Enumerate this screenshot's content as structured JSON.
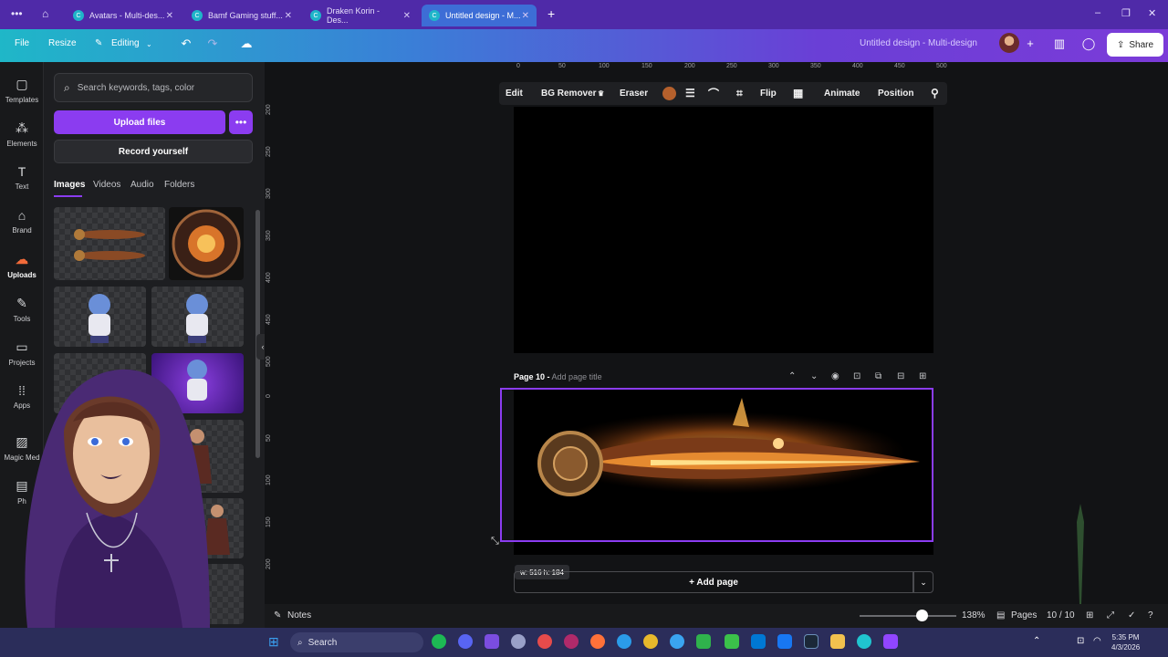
{
  "browser": {
    "tabs": [
      {
        "label": "Avatars - Multi-des..."
      },
      {
        "label": "Bamf Gaming stuff..."
      },
      {
        "label": "Draken Korin - Des..."
      },
      {
        "label": "Untitled design - M..."
      }
    ],
    "new_tab": "+",
    "window_controls": [
      "–",
      "❐",
      "✕"
    ]
  },
  "topbar": {
    "file": "File",
    "resize": "Resize",
    "editing": "Editing",
    "title": "Untitled design - Multi-design",
    "share": "Share"
  },
  "rail": {
    "items": [
      {
        "label": "Templates",
        "icon": "templates-icon"
      },
      {
        "label": "Elements",
        "icon": "elements-icon"
      },
      {
        "label": "Text",
        "icon": "text-icon"
      },
      {
        "label": "Brand",
        "icon": "brand-icon"
      },
      {
        "label": "Uploads",
        "icon": "uploads-icon"
      },
      {
        "label": "Tools",
        "icon": "tools-icon"
      },
      {
        "label": "Projects",
        "icon": "projects-icon"
      },
      {
        "label": "Apps",
        "icon": "apps-icon"
      },
      {
        "label": "Magic Med",
        "icon": "magic-media-icon"
      },
      {
        "label": "Ph",
        "icon": "photos-icon"
      }
    ]
  },
  "panel": {
    "search_placeholder": "Search keywords, tags, color",
    "upload": "Upload files",
    "record": "Record yourself",
    "tabs": [
      "Images",
      "Videos",
      "Audio",
      "Folders"
    ]
  },
  "ruler": {
    "top": [
      "0",
      "50",
      "100",
      "150",
      "200",
      "250",
      "300",
      "350",
      "400",
      "450",
      "500"
    ],
    "left": [
      "200",
      "250",
      "300",
      "350",
      "400",
      "450",
      "500",
      "0",
      "50",
      "100",
      "150",
      "200"
    ]
  },
  "toolbar": {
    "edit": "Edit",
    "bg_remover": "BG Remover",
    "eraser": "Eraser",
    "flip": "Flip",
    "animate": "Animate",
    "position": "Position",
    "swatch_color": "#b5602c"
  },
  "page": {
    "number": "Page 10 -",
    "title_placeholder": "Add page title",
    "size_tip": "w: 516 h: 184",
    "add_page": "+ Add page"
  },
  "footer": {
    "notes": "Notes",
    "zoom": "138%",
    "pages": "Pages",
    "page_count": "10 / 10"
  },
  "taskbar": {
    "search": "Search",
    "time": "5:35 PM",
    "date": "4/3/2026"
  },
  "colors": {
    "accent": "#8b3cf0",
    "tab_active": "#3d6dd6"
  }
}
